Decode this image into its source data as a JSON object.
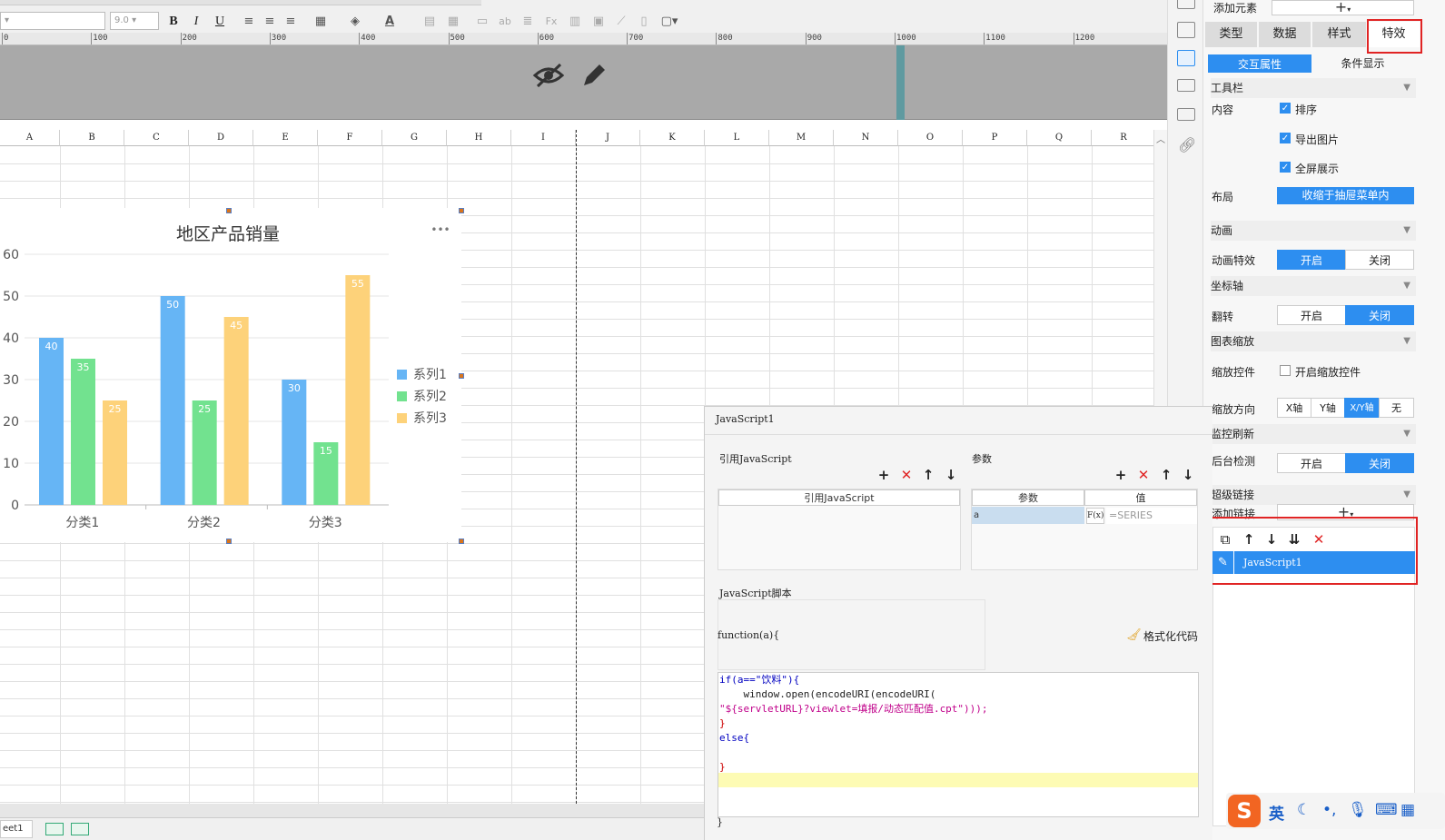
{
  "toolbar": {
    "font_size": "9.0",
    "bold": "B",
    "italic": "I",
    "underline": "U"
  },
  "ruler": {
    "ticks": [
      "0",
      "100",
      "200",
      "300",
      "400",
      "500",
      "600",
      "700",
      "800",
      "900",
      "1000",
      "1100",
      "1200"
    ]
  },
  "sheet": {
    "columns": [
      "A",
      "B",
      "C",
      "D",
      "E",
      "F",
      "G",
      "H",
      "I",
      "J",
      "K",
      "L",
      "M",
      "N",
      "O",
      "P",
      "Q",
      "R"
    ],
    "tab_label": "eet1"
  },
  "chart_data": {
    "type": "bar",
    "title": "地区产品销量",
    "categories": [
      "分类1",
      "分类2",
      "分类3"
    ],
    "series": [
      {
        "name": "系列1",
        "values": [
          40,
          50,
          30
        ],
        "color": "#66b5f5"
      },
      {
        "name": "系列2",
        "values": [
          35,
          25,
          15
        ],
        "color": "#72e28f"
      },
      {
        "name": "系列3",
        "values": [
          25,
          45,
          55
        ],
        "color": "#fdd27a"
      }
    ],
    "ylim": [
      0,
      60
    ],
    "yticks": [
      0,
      10,
      20,
      30,
      40,
      50,
      60
    ],
    "grid": true,
    "legend": "right",
    "more_menu": "•••"
  },
  "panel": {
    "add_element": "添加元素",
    "tabs": [
      "类型",
      "数据",
      "样式",
      "特效"
    ],
    "subtabs": [
      "交互属性",
      "条件显示"
    ],
    "toolbar_section": "工具栏",
    "content_label": "内容",
    "checks": [
      {
        "label": "排序",
        "checked": true
      },
      {
        "label": "导出图片",
        "checked": true
      },
      {
        "label": "全屏展示",
        "checked": true
      }
    ],
    "layout_label": "布局",
    "layout_value": "收缩于抽屉菜单内",
    "animation_section": "动画",
    "animation_label": "动画特效",
    "on": "开启",
    "off": "关闭",
    "axis_section": "坐标轴",
    "flip_label": "翻转",
    "zoom_section": "图表缩放",
    "zoom_ctrl_label": "缩放控件",
    "zoom_ctrl_check": "开启缩放控件",
    "zoom_dir_label": "缩放方向",
    "zoom_dirs": [
      "X轴",
      "Y轴",
      "X/Y轴",
      "无"
    ],
    "monitor_section": "监控刷新",
    "backend_label": "后台检测",
    "hyperlink_section": "超级链接",
    "add_link_label": "添加链接",
    "link_item": "JavaScript1"
  },
  "dialog": {
    "title": "JavaScript1",
    "ref_js_label": "引用JavaScript",
    "params_label": "参数",
    "ref_js_col": "引用JavaScript",
    "param_col": "参数",
    "value_col": "值",
    "param_name": "a",
    "param_value": "=SERIES",
    "fx": "F(x)",
    "script_label": "JavaScript脚本",
    "function_sig": "function(a){",
    "format_code": "格式化代码",
    "closing": "}",
    "code_lines": [
      "if(a==\"饮料\"){",
      "    window.open(encodeURI(encodeURI(",
      "\"${servletURL}?viewlet=填报/动态匹配值.cpt\")));",
      "}",
      "else{",
      "",
      "}"
    ]
  },
  "ime": {
    "lang": "英"
  }
}
